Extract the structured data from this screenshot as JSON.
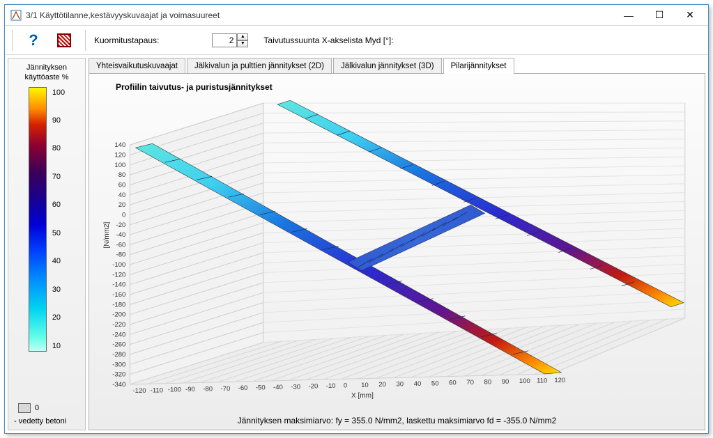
{
  "window": {
    "title": "3/1  Käyttötilanne,kestävyyskuvaajat ja voimasuureet"
  },
  "toolbar": {
    "load_case_label": "Kuormitustapaus:",
    "load_case_value": "2",
    "bending_label": "Taivutussuunta X-akselista Myd [°]:"
  },
  "legend": {
    "title": "Jännityksen käyttöaste %",
    "ticks": [
      "100",
      "90",
      "80",
      "70",
      "60",
      "50",
      "40",
      "30",
      "20",
      "10"
    ],
    "zero_label": "0",
    "caption": "- vedetty betoni"
  },
  "tabs": {
    "t1": "Yhteisvaikutuskuvaajat",
    "t2": "Jälkivalun ja pulttien jännitykset (2D)",
    "t3": "Jälkivalun jännitykset (3D)",
    "t4": "Pilarijännitykset"
  },
  "chart": {
    "title": "Profiilin taivutus- ja puristusjännitykset",
    "x_label": "X [mm]",
    "y_label": "[N/mm2]",
    "footer": "Jännityksen maksimiarvo: fy = 355.0 N/mm2, laskettu maksimiarvo fd = -355.0 N/mm2"
  },
  "chart_data": {
    "type": "line",
    "title": "Profiilin taivutus- ja puristusjännitykset",
    "xlabel": "X [mm]",
    "ylabel": "N/mm2",
    "x": [
      -125,
      -120,
      -110,
      -100,
      -90,
      -80,
      -70,
      -60,
      -50,
      -40,
      -30,
      -20,
      -10,
      0,
      10,
      20,
      30,
      40,
      50,
      60,
      70,
      80,
      90,
      100,
      110,
      120,
      125
    ],
    "series": [
      {
        "name": "flange-near",
        "values": [
          150,
          140,
          120,
          100,
          80,
          60,
          40,
          20,
          0,
          -20,
          -40,
          -60,
          -80,
          -100,
          -120,
          -140,
          -160,
          -180,
          -200,
          -220,
          -240,
          -260,
          -280,
          -300,
          -320,
          -340,
          -345
        ]
      },
      {
        "name": "flange-far",
        "values": [
          150,
          140,
          120,
          100,
          80,
          60,
          40,
          20,
          0,
          -20,
          -40,
          -60,
          -80,
          -100,
          -120,
          -140,
          -160,
          -180,
          -200,
          -220,
          -240,
          -260,
          -280,
          -300,
          -320,
          -340,
          -345
        ]
      }
    ],
    "web": {
      "x": [
        0,
        0
      ],
      "stress": [
        -100,
        -100
      ],
      "extent": "connects both flanges near x≈0 at about -100 N/mm2"
    },
    "y_ticks": [
      140,
      120,
      100,
      80,
      60,
      40,
      20,
      0,
      -20,
      -40,
      -60,
      -80,
      -100,
      -120,
      -140,
      -160,
      -180,
      -200,
      -220,
      -240,
      -260,
      -280,
      -300,
      -320,
      -340
    ],
    "x_ticks": [
      -120,
      -110,
      -100,
      -90,
      -80,
      -70,
      -60,
      -50,
      -40,
      -30,
      -20,
      -10,
      0,
      10,
      20,
      30,
      40,
      50,
      60,
      70,
      80,
      90,
      100,
      110,
      120
    ],
    "xlim": [
      -130,
      130
    ],
    "ylim": [
      -350,
      150
    ],
    "note": "3D oblique rendering of I-profile stress bands; color maps to |stress|/fy×100%"
  }
}
